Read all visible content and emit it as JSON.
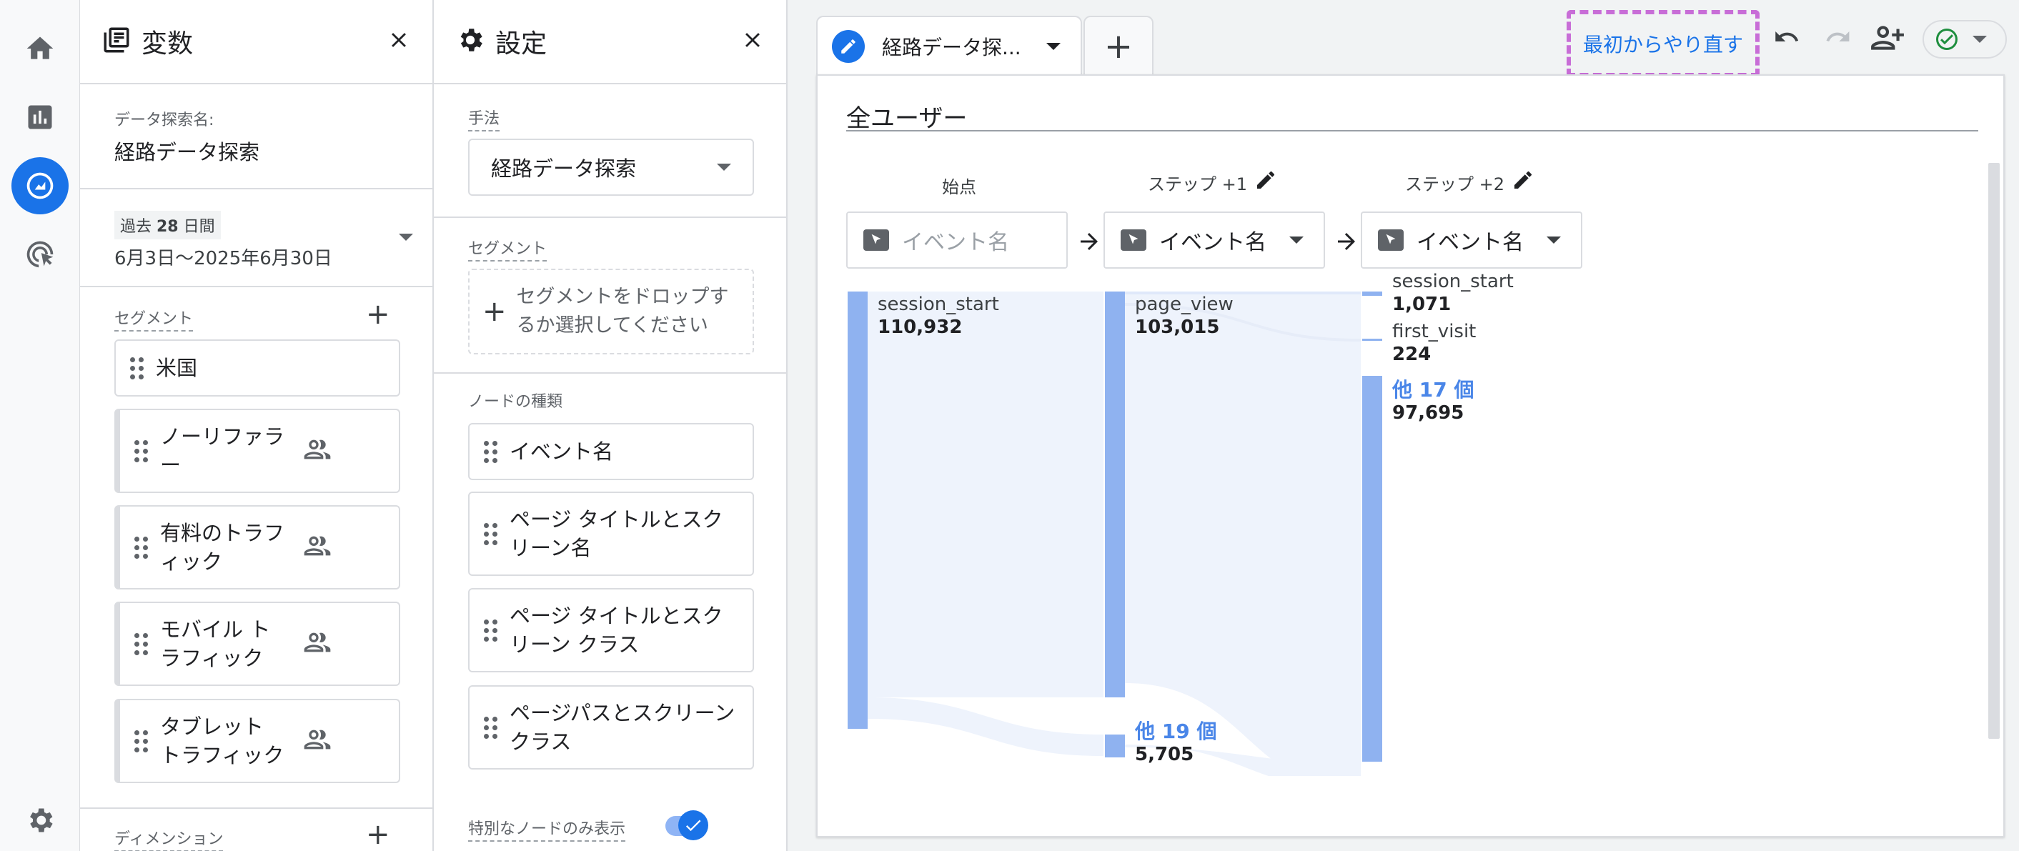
{
  "variables": {
    "title": "変数",
    "exploration_name_label": "データ探索名:",
    "exploration_name": "経路データ探索",
    "date_range_label_prefix": "過去 ",
    "date_range_days": "28",
    "date_range_label_suffix": " 日間",
    "date_range": "6月3日〜2025年6月30日",
    "segments_label": "セグメント",
    "segments": [
      "米国",
      "ノーリファラー",
      "有料のトラフィック",
      "モバイル トラフィック",
      "タブレット トラフィック"
    ],
    "dimensions_label": "ディメンション"
  },
  "settings": {
    "title": "設定",
    "technique_label": "手法",
    "technique_value": "経路データ探索",
    "segment_label": "セグメント",
    "segment_drop_text": "セグメントをドロップするか選択してください",
    "node_type_label": "ノードの種類",
    "node_types": [
      "イベント名",
      "ページ タイトルとスクリーン名",
      "ページ タイトルとスクリーン クラス",
      "ページパスとスクリーン クラス"
    ],
    "special_nodes_label": "特別なノードのみ表示"
  },
  "toolbar": {
    "tab_name": "経路データ探...",
    "restart_label": "最初からやり直す",
    "highlight_color": "#c86dd7"
  },
  "canvas": {
    "segment_title": "全ユーザー",
    "start_label": "始点",
    "step1_label": "ステップ +1",
    "step2_label": "ステップ +2",
    "node_placeholder": "イベント名",
    "node_select_value": "イベント名"
  },
  "flow": {
    "accent": "#8fb2f0",
    "link": "#eef3fc",
    "more_color": "#4a86e8",
    "start": {
      "label": "session_start",
      "value": "110,932"
    },
    "step1": [
      {
        "label": "page_view",
        "value": "103,015"
      },
      {
        "label": "他 19 個",
        "value": "5,705"
      }
    ],
    "step2": [
      {
        "label": "session_start",
        "value": "1,071"
      },
      {
        "label": "first_visit",
        "value": "224"
      },
      {
        "label": "他 17 個",
        "value": "97,695"
      }
    ]
  }
}
